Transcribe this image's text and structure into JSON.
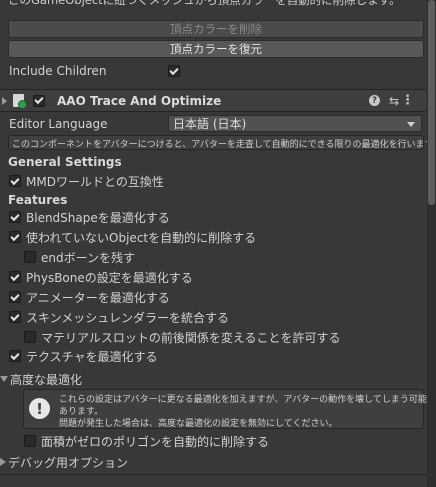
{
  "top_note": "このGameObjectに紐つくメッシュから頂点カラーを自動的に削除します。",
  "buttons": {
    "remove_vertex_color": "頂点カラーを削除",
    "restore_vertex_color": "頂点カラーを復元"
  },
  "include_children": {
    "label": "Include Children",
    "checked": true
  },
  "component": {
    "title": "AAO Trace And Optimize",
    "editor_language_label": "Editor Language",
    "editor_language_value": "日本語 (日本)",
    "description": "このコンポーネントをアバターにつけると、アバターを走査して自動的にできる限りの最適化を行います。"
  },
  "general_settings": {
    "title": "General Settings",
    "items": [
      {
        "label": "MMDワールドとの互換性",
        "checked": true
      }
    ]
  },
  "features": {
    "title": "Features",
    "items": [
      {
        "label": "BlendShapeを最適化する",
        "checked": true
      },
      {
        "label": "使われていないObjectを自動的に削除する",
        "checked": true
      },
      {
        "label": "endボーンを残す",
        "checked": false
      },
      {
        "label": "PhysBoneの設定を最適化する",
        "checked": true
      },
      {
        "label": "アニメーターを最適化する",
        "checked": true
      },
      {
        "label": "スキンメッシュレンダラーを統合する",
        "checked": true
      },
      {
        "label": "マテリアルスロットの前後関係を変えることを許可する",
        "checked": false
      },
      {
        "label": "テクスチャを最適化する",
        "checked": true
      }
    ]
  },
  "advanced": {
    "title": "高度な最適化",
    "warning_line1": "これらの設定はアバターに更なる最適化を加えますが、アバターの動作を壊してしまう可能性も",
    "warning_line2": "あります。",
    "warning_line3": "問題が発生した場合は、高度な最適化の設定を無効にしてください。",
    "zero_area_polygon": {
      "label": "面積がゼロのポリゴンを自動的に削除する",
      "checked": false
    }
  },
  "debug": {
    "title": "デバッグ用オプション"
  },
  "colors": {
    "panel_bg": "#383838",
    "header_bg": "#3e3e3e",
    "button_bg": "#585858",
    "text": "#d2d2d2"
  }
}
